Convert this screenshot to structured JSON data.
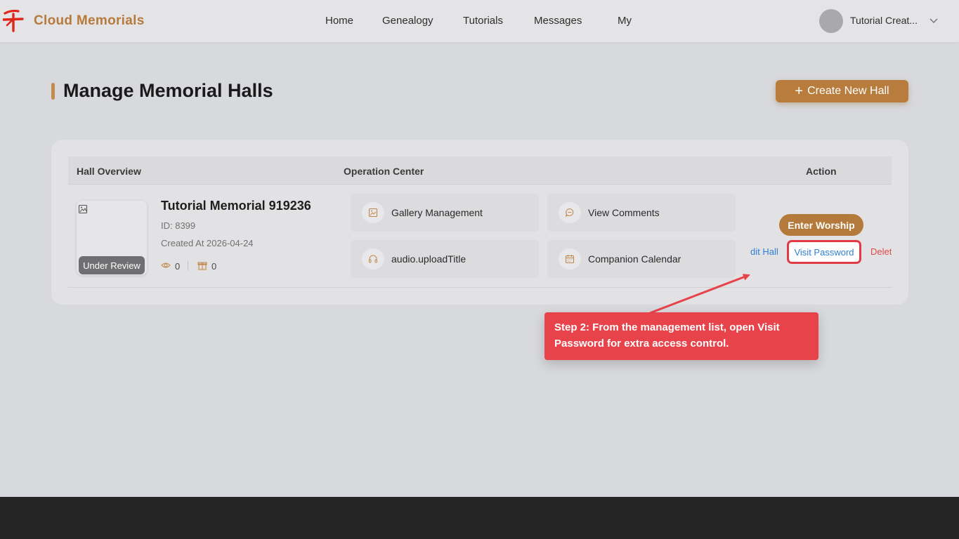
{
  "header": {
    "brand": "Cloud Memorials",
    "nav": [
      "Home",
      "Genealogy",
      "Tutorials",
      "Messages",
      "My"
    ],
    "user_name": "Tutorial Creat...",
    "logo_icon": "calligraphy-logo-icon",
    "brand_color": "#b77a3d",
    "logo_color": "#e0261b"
  },
  "page": {
    "title": "Manage Memorial Halls",
    "create_button": "Create New Hall"
  },
  "table": {
    "headers": [
      "Hall Overview",
      "Operation Center",
      "Action"
    ],
    "rows": [
      {
        "name": "Tutorial Memorial 919236",
        "id": "ID: 8399",
        "created": "Created At 2026-04-24",
        "status": "Under Review",
        "views": "0",
        "gifts": "0",
        "operations": [
          {
            "label": "Gallery Management",
            "icon": "image-icon"
          },
          {
            "label": "View Comments",
            "icon": "comment-icon"
          },
          {
            "label": "audio.uploadTitle",
            "icon": "headphones-icon"
          },
          {
            "label": "Companion Calendar",
            "icon": "calendar-icon"
          }
        ],
        "actions": {
          "worship": "Enter Worship",
          "edit": "dit Hall",
          "visit_password": "Visit Password",
          "delete": "Delet"
        }
      }
    ]
  },
  "callout": {
    "text": "Step 2: From the management list, open Visit Password for extra access control.",
    "color": "#e8434a"
  },
  "colors": {
    "accent": "#b87d3c",
    "link": "#2f7fd6",
    "danger": "#e04a4a",
    "highlight": "#e23a44"
  }
}
